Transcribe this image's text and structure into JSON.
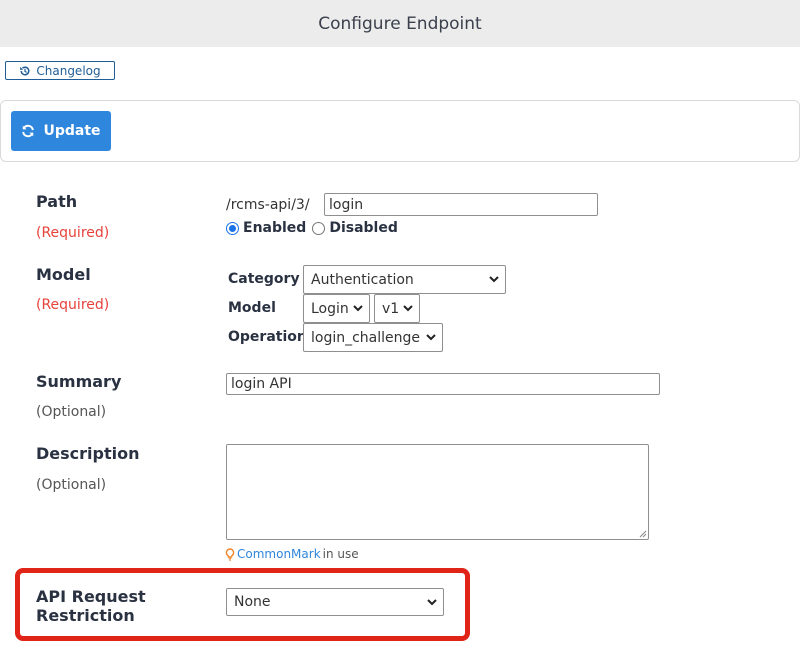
{
  "header": {
    "title": "Configure Endpoint"
  },
  "toolbar": {
    "changelog_label": "Changelog",
    "update_label": "Update"
  },
  "path": {
    "label": "Path",
    "status": "(Required)",
    "prefix": "/rcms-api/3/",
    "value": "login",
    "enabled_label": "Enabled",
    "disabled_label": "Disabled",
    "selected": "Enabled"
  },
  "model": {
    "label": "Model",
    "status": "(Required)",
    "category_label": "Category",
    "category_value": "Authentication",
    "model_label": "Model",
    "model_value": "Login",
    "version_value": "v1",
    "operation_label": "Operation",
    "operation_value": "login_challenge"
  },
  "summary": {
    "label": "Summary",
    "status": "(Optional)",
    "value": "login API"
  },
  "description": {
    "label": "Description",
    "status": "(Optional)",
    "value": "",
    "commonmark_link": "CommonMark",
    "commonmark_suffix": "in use"
  },
  "restriction": {
    "label_line1": "API Request",
    "label_line2": "Restriction",
    "value": "None"
  },
  "colors": {
    "accent": "#2f86dd",
    "required": "#e8413c",
    "highlight": "#e02418",
    "header_bg": "#ececec"
  }
}
